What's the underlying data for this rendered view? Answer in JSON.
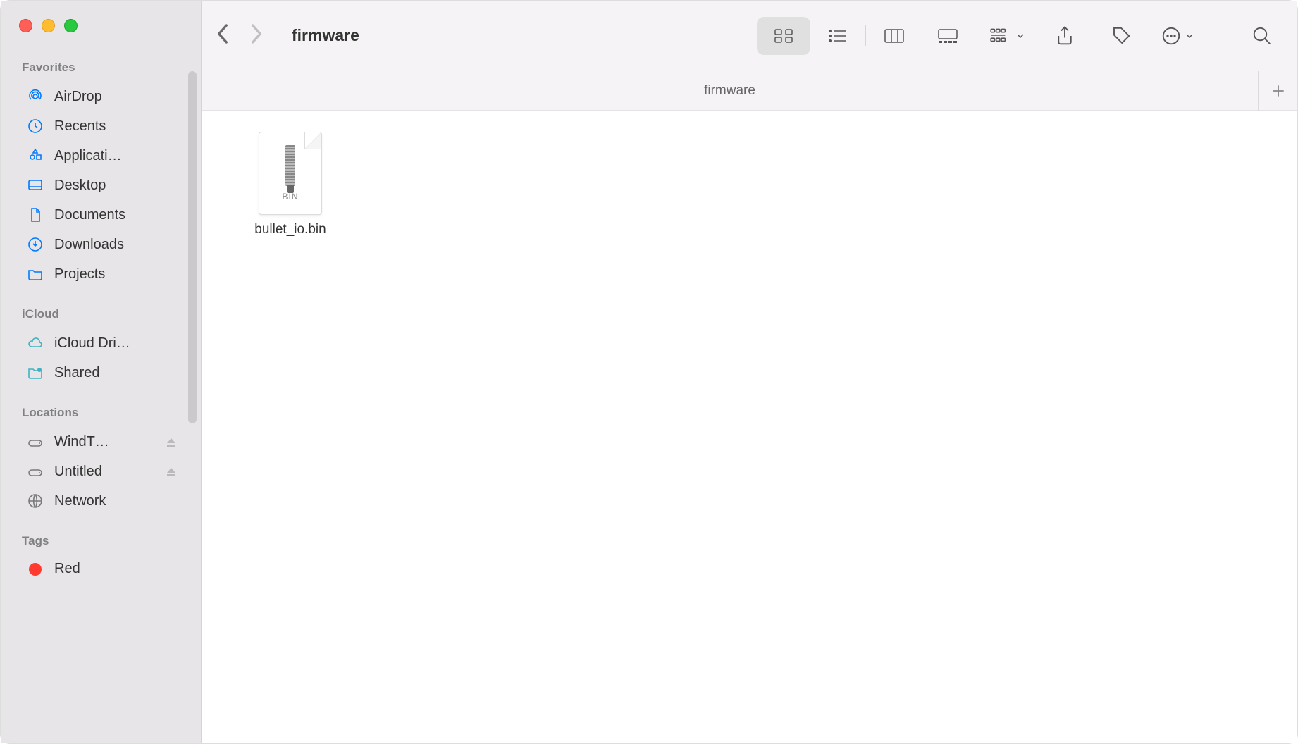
{
  "window_title": "firmware",
  "tab_title": "firmware",
  "sidebar": {
    "sections": [
      {
        "header": "Favorites",
        "items": [
          {
            "label": "AirDrop",
            "icon": "airdrop"
          },
          {
            "label": "Recents",
            "icon": "clock"
          },
          {
            "label": "Applicati…",
            "icon": "apps"
          },
          {
            "label": "Desktop",
            "icon": "desktop"
          },
          {
            "label": "Documents",
            "icon": "doc"
          },
          {
            "label": "Downloads",
            "icon": "download"
          },
          {
            "label": "Projects",
            "icon": "folder"
          }
        ]
      },
      {
        "header": "iCloud",
        "items": [
          {
            "label": "iCloud Dri…",
            "icon": "cloud"
          },
          {
            "label": "Shared",
            "icon": "shared"
          }
        ]
      },
      {
        "header": "Locations",
        "items": [
          {
            "label": "WindT…",
            "icon": "drive",
            "eject": true
          },
          {
            "label": "Untitled",
            "icon": "drive",
            "eject": true
          },
          {
            "label": "Network",
            "icon": "globe"
          }
        ]
      },
      {
        "header": "Tags",
        "items": [
          {
            "label": "Red",
            "icon": "tag-red"
          }
        ]
      }
    ]
  },
  "files": [
    {
      "name": "bullet_io.bin",
      "type_label": "BIN"
    }
  ]
}
